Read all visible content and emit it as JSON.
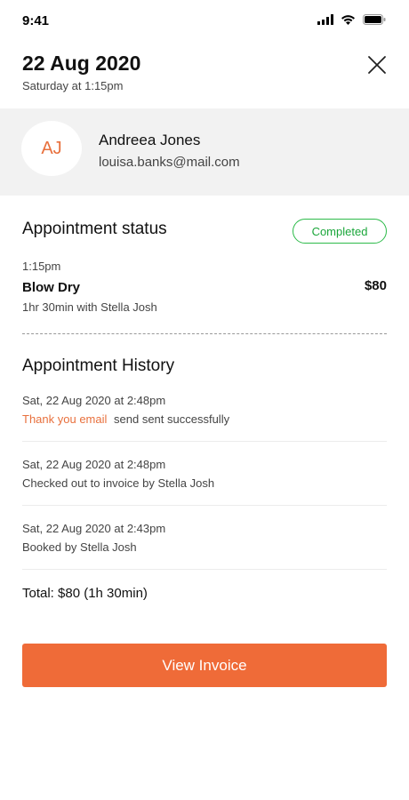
{
  "status_bar": {
    "time": "9:41"
  },
  "header": {
    "date": "22 Aug 2020",
    "subtitle": "Saturday at 1:15pm"
  },
  "client": {
    "initials": "AJ",
    "name": "Andreea Jones",
    "email": "louisa.banks@mail.com"
  },
  "appointment_status": {
    "title": "Appointment status",
    "badge": "Completed",
    "time": "1:15pm",
    "service": "Blow Dry",
    "price": "$80",
    "duration": "1hr 30min with Stella Josh"
  },
  "history": {
    "title": "Appointment History",
    "items": [
      {
        "date": "Sat, 22 Aug 2020 at 2:48pm",
        "link": "Thank you email",
        "desc": "send sent successfully"
      },
      {
        "date": "Sat, 22 Aug 2020 at 2:48pm",
        "desc": "Checked out to invoice by Stella Josh"
      },
      {
        "date": "Sat, 22 Aug 2020 at 2:43pm",
        "desc": "Booked by Stella Josh"
      }
    ]
  },
  "total": "Total: $80 (1h 30min)",
  "invoice_button": "View Invoice",
  "colors": {
    "accent": "#ef6b38",
    "success": "#1aa63a"
  }
}
